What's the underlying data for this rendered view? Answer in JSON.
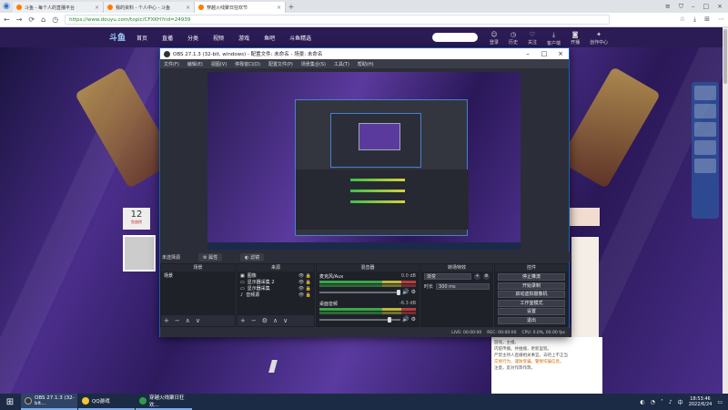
{
  "browser": {
    "tabs": [
      {
        "label": "斗鱼 - 每个人的直播平台",
        "active": false
      },
      {
        "label": "我的资料 - 个人中心 - 斗鱼",
        "active": false
      },
      {
        "label": "穿越火线聚日狂欢节",
        "active": true
      }
    ],
    "new_tab": "+",
    "url": "https://www.douyu.com/topic/CFXKH?rid=24939"
  },
  "site": {
    "logo": "斗鱼",
    "nav": [
      "首页",
      "直播",
      "分类",
      "视频",
      "游戏",
      "鱼吧",
      "斗鱼精选"
    ],
    "header_icons": [
      "登录",
      "历史",
      "关注",
      "客户端",
      "开播",
      "创作中心"
    ],
    "room_number": "12",
    "room_badge": "鱼翅榜",
    "chat_lines": [
      {
        "text": "游戏，主播。",
        "hl": false
      },
      {
        "text": "内容传播。并推播，更新里程。",
        "hl": false
      },
      {
        "text": "严禁主持人直播相关事宜，去吧上不正当",
        "hl": false
      },
      {
        "text": "交易行为，谨防受骗。警惕诈骗信息。",
        "hl": true
      },
      {
        "text": "注意，反对作弊作弊。",
        "hl": false
      }
    ]
  },
  "obs": {
    "title": "OBS 27.1.3 (32-bit, windows) - 配置文件: 未命名 - 场景: 未命名",
    "menu": [
      "文件(F)",
      "编辑(E)",
      "视图(V)",
      "停靠窗口(D)",
      "配置文件(P)",
      "场景集合(S)",
      "工具(T)",
      "帮助(H)"
    ],
    "status_strip": {
      "left": "未选择源",
      "prop": "属性",
      "filter": "滤镜"
    },
    "docks": {
      "scenes": {
        "title": "场景",
        "items": [
          "场景"
        ]
      },
      "sources": {
        "title": "来源",
        "items": [
          "图像",
          "显示器采集 2",
          "显示器采集",
          "音频源"
        ]
      },
      "mixer": {
        "title": "混音器",
        "channels": [
          {
            "name": "麦克风/Aux",
            "db": "0.0 dB"
          },
          {
            "name": "桌面音频",
            "db": "-6.3 dB"
          }
        ]
      },
      "transitions": {
        "title": "转场特效",
        "type": "渐变",
        "duration_label": "时长",
        "duration": "300 ms"
      },
      "controls": {
        "title": "控件",
        "buttons": [
          "停止推流",
          "开始录制",
          "启动虚拟摄像机",
          "工作室模式",
          "设置",
          "退出"
        ]
      }
    },
    "statusbar": {
      "live": "LIVE: 00:00:00",
      "rec": "REC: 00:00:00",
      "cpu": "CPU: 0.0%, 60.00 fps"
    }
  },
  "taskbar": {
    "items": [
      {
        "label": "OBS 27.1.3 (32-bit...",
        "color": "#333333"
      },
      {
        "label": "QQ游戏",
        "color": "#f4c430"
      },
      {
        "label": "穿越火线聚日狂欢...",
        "color": "#2e9c4a"
      }
    ],
    "time": "18:53:46",
    "date": "2022/6/24"
  }
}
